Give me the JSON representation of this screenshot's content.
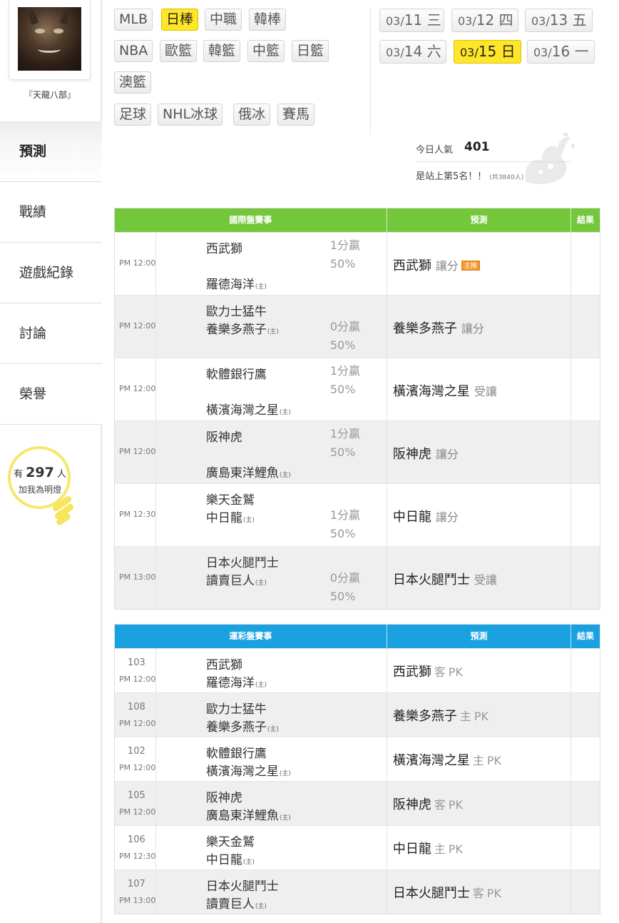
{
  "user": {
    "name": "『天龍八部』"
  },
  "nav": [
    {
      "label": "預測"
    },
    {
      "label": "戰績"
    },
    {
      "label": "遊戲紀錄"
    },
    {
      "label": "討論"
    },
    {
      "label": "榮譽"
    }
  ],
  "fans": {
    "prefix": "有",
    "count": "297",
    "suffix": "人",
    "caption": "加我為明燈"
  },
  "sports": [
    "MLB",
    "日棒",
    "中職",
    "韓棒",
    "NBA",
    "歐籃",
    "韓籃",
    "中籃",
    "日籃",
    "澳籃",
    "足球",
    "NHL冰球",
    "俄冰",
    "賽馬"
  ],
  "dates": [
    {
      "date": "03/",
      "day": "11",
      "weekday": "三"
    },
    {
      "date": "03/",
      "day": "12",
      "weekday": "四"
    },
    {
      "date": "03/",
      "day": "13",
      "weekday": "五"
    },
    {
      "date": "03/",
      "day": "14",
      "weekday": "六"
    },
    {
      "date": "03/",
      "day": "15",
      "weekday": "日"
    },
    {
      "date": "03/",
      "day": "16",
      "weekday": "一"
    }
  ],
  "popularity": {
    "label": "今日人氣",
    "value": "401",
    "rank_text": "是站上第5名！！",
    "rank_total": "(共3840人)"
  },
  "intl": {
    "headers": [
      "國際盤賽事",
      "預測",
      "結果"
    ],
    "rows": [
      {
        "time": "PM 12:00",
        "away": "西武獅",
        "home": "羅德海洋",
        "home_mark": "(主)",
        "odds_a": "1分贏",
        "odds_b": "50%",
        "pred_team": "西武獅",
        "pred_type": "讓分",
        "badge": "主推"
      },
      {
        "time": "PM 12:00",
        "away": "歐力士猛牛",
        "home": "養樂多燕子",
        "home_mark": "(主)",
        "odds_a": "0分贏",
        "odds_b": "50%",
        "pred_team": "養樂多燕子",
        "pred_type": "讓分",
        "badge": ""
      },
      {
        "time": "PM 12:00",
        "away": "軟體銀行鷹",
        "home": "橫濱海灣之星",
        "home_mark": "(主)",
        "odds_a": "1分贏",
        "odds_b": "50%",
        "pred_team": "橫濱海灣之星",
        "pred_type": "受讓",
        "badge": ""
      },
      {
        "time": "PM 12:00",
        "away": "阪神虎",
        "home": "廣島東洋鯉魚",
        "home_mark": "(主)",
        "odds_a": "1分贏",
        "odds_b": "50%",
        "pred_team": "阪神虎",
        "pred_type": "讓分",
        "badge": ""
      },
      {
        "time": "PM 12:30",
        "away": "樂天金鷲",
        "home": "中日龍",
        "home_mark": "(主)",
        "odds_a": "1分贏",
        "odds_b": "50%",
        "pred_team": "中日龍",
        "pred_type": "讓分",
        "badge": ""
      },
      {
        "time": "PM 13:00",
        "away": "日本火腿鬥士",
        "home": "讀賣巨人",
        "home_mark": "(主)",
        "odds_a": "0分贏",
        "odds_b": "50%",
        "pred_team": "日本火腿鬥士",
        "pred_type": "受讓",
        "badge": ""
      }
    ]
  },
  "lottery": {
    "headers": [
      "運彩盤賽事",
      "預測",
      "結果"
    ],
    "rows": [
      {
        "no": "103",
        "time": "PM 12:00",
        "away": "西武獅",
        "home": "羅德海洋",
        "home_mark": "(主)",
        "pred_team": "西武獅",
        "side": "客",
        "pk": "PK"
      },
      {
        "no": "108",
        "time": "PM 12:00",
        "away": "歐力士猛牛",
        "home": "養樂多燕子",
        "home_mark": "(主)",
        "pred_team": "養樂多燕子",
        "side": "主",
        "pk": "PK"
      },
      {
        "no": "102",
        "time": "PM 12:00",
        "away": "軟體銀行鷹",
        "home": "橫濱海灣之星",
        "home_mark": "(主)",
        "pred_team": "橫濱海灣之星",
        "side": "主",
        "pk": "PK"
      },
      {
        "no": "105",
        "time": "PM 12:00",
        "away": "阪神虎",
        "home": "廣島東洋鯉魚",
        "home_mark": "(主)",
        "pred_team": "阪神虎",
        "side": "客",
        "pk": "PK"
      },
      {
        "no": "106",
        "time": "PM 12:30",
        "away": "樂天金鷲",
        "home": "中日龍",
        "home_mark": "(主)",
        "pred_team": "中日龍",
        "side": "主",
        "pk": "PK"
      },
      {
        "no": "107",
        "time": "PM 13:00",
        "away": "日本火腿鬥士",
        "home": "讀賣巨人",
        "home_mark": "(主)",
        "pred_team": "日本火腿鬥士",
        "side": "客",
        "pk": "PK"
      }
    ]
  }
}
